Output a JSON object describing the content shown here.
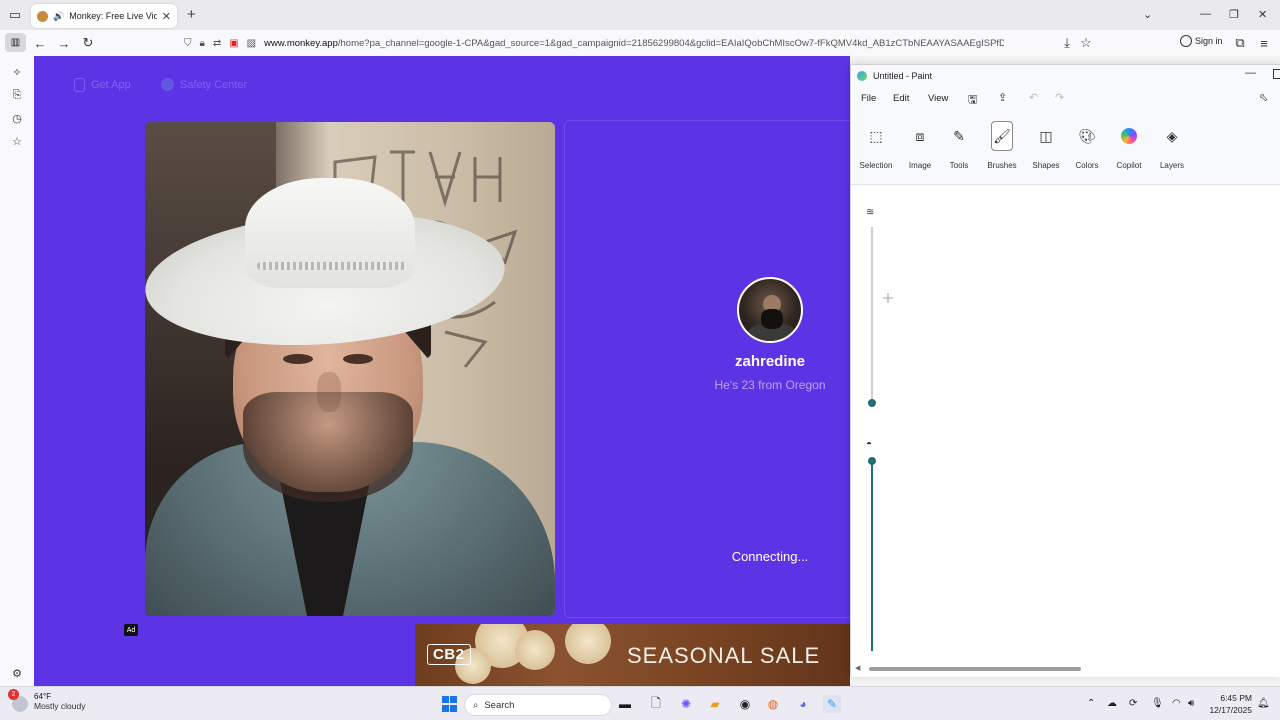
{
  "browser": {
    "tab_title": "Monkey: Free Live Video Ch",
    "url_domain": "www.monkey.app",
    "url_path": "/home?pa_channel=google-1-CPA&gad_source=1&gad_campaignid=21856299804&gclid=EAIaIQobChMIscOw7-fFkQMV4kd_AB1zCTbNEAAYASAAEgISPfD_BwE",
    "sign_in_label": "Sign in"
  },
  "page": {
    "get_app_label": "Get App",
    "safety_center_label": "Safety Center",
    "remote_user_name": "zahredine",
    "remote_user_info": "He's 23 from Oregon",
    "status_text": "Connecting...",
    "ad_badge": "Ad",
    "ad_logo": "CB2",
    "ad_text": "SEASONAL SALE"
  },
  "paint": {
    "window_title": "Untitled - Paint",
    "menu": [
      "File",
      "Edit",
      "View"
    ],
    "ribbon": [
      "Selection",
      "Image",
      "Tools",
      "Brushes",
      "Shapes",
      "Colors",
      "Copilot",
      "Layers"
    ],
    "size_slider_value": 0.02,
    "opacity_slider_value": 1.0
  },
  "taskbar": {
    "weather_temp": "64°F",
    "weather_desc": "Mostly cloudy",
    "weather_badge": "2",
    "search_label": "Search",
    "time": "6:45 PM",
    "date": "12/17/2025"
  },
  "colors": {
    "monkey_purple": "#5d33e6",
    "paint_accent": "#1f6f78"
  }
}
